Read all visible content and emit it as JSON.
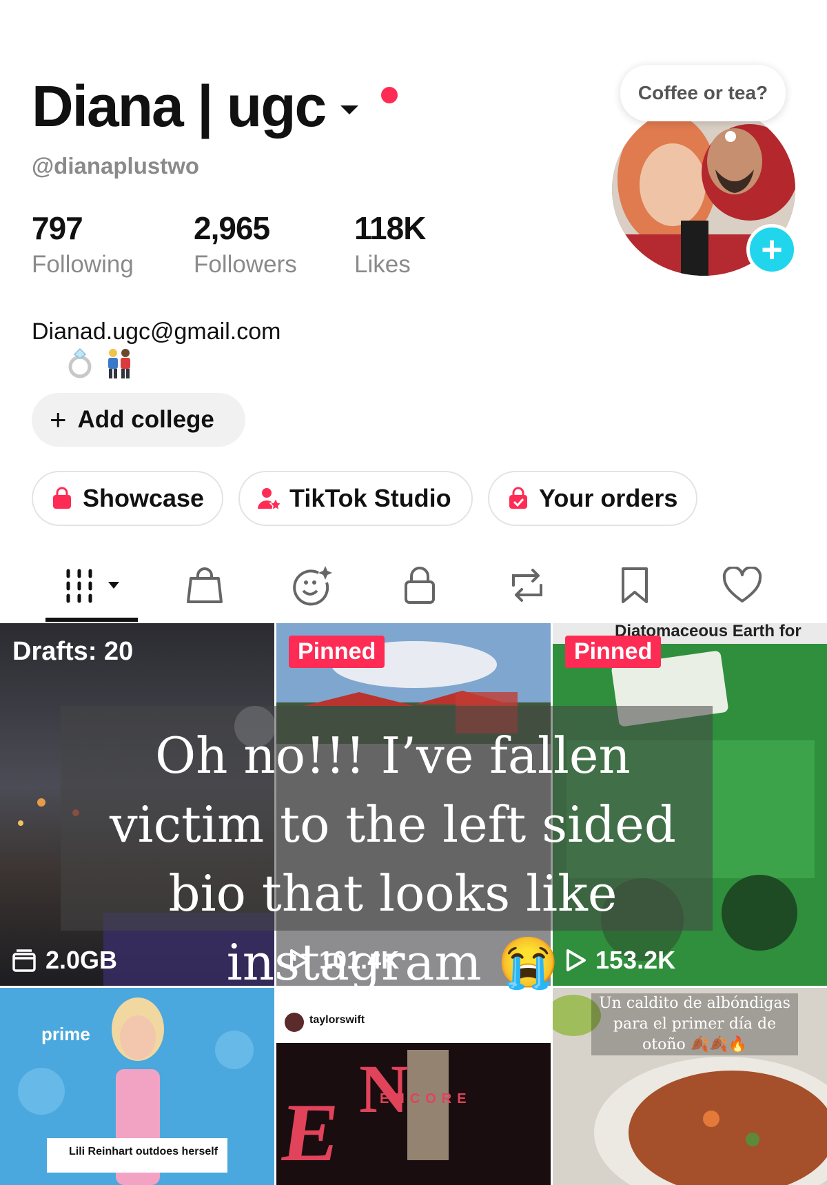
{
  "profile": {
    "display_name": "Diana | ugc",
    "username": "@dianaplustwo",
    "bio_line": "Dianad.ugc@gmail.com",
    "bio_emojis": "💍 👫",
    "note": "Coffee or tea?",
    "add_college_label": "Add college"
  },
  "stats": [
    {
      "value": "797",
      "label": "Following"
    },
    {
      "value": "2,965",
      "label": "Followers"
    },
    {
      "value": "118K",
      "label": "Likes"
    }
  ],
  "action_pills": [
    {
      "label": "Showcase",
      "icon": "shopping-bag-icon"
    },
    {
      "label": "TikTok Studio",
      "icon": "creator-studio-icon"
    },
    {
      "label": "Your orders",
      "icon": "orders-bag-icon"
    }
  ],
  "tabs": [
    {
      "name": "videos-grid",
      "icon": "grid-icon",
      "selected": true
    },
    {
      "name": "shop",
      "icon": "shopping-bag-icon"
    },
    {
      "name": "ai-self",
      "icon": "smiley-sparkle-icon"
    },
    {
      "name": "private",
      "icon": "lock-icon"
    },
    {
      "name": "reposts",
      "icon": "repost-icon"
    },
    {
      "name": "favorites",
      "icon": "bookmark-icon"
    },
    {
      "name": "liked",
      "icon": "heart-icon"
    }
  ],
  "grid": {
    "drafts_label": "Drafts: 20",
    "drafts_size": "2.0GB",
    "pinned_label": "Pinned",
    "cells": [
      {
        "views": "101.4K"
      },
      {
        "views": "153.2K"
      }
    ],
    "cell3_top_text": "Diatomaceous Earth for fleas",
    "cell4_caption": "Lili Reinhart outdoes herself",
    "cell4_logo": "prime",
    "cell5_account": "taylorswift",
    "cell5_title": "ENCORE",
    "cell6_caption": "Un caldito de albóndigas para el primer día de otoño 🍂🍂🔥"
  },
  "overlay_caption": "Oh no!!! I’ve fallen victim to the left sided bio that looks like instagram 😭",
  "colors": {
    "accent_red": "#fe2c55",
    "accent_cyan": "#20d5ec",
    "muted_text": "#8a8a8a"
  }
}
